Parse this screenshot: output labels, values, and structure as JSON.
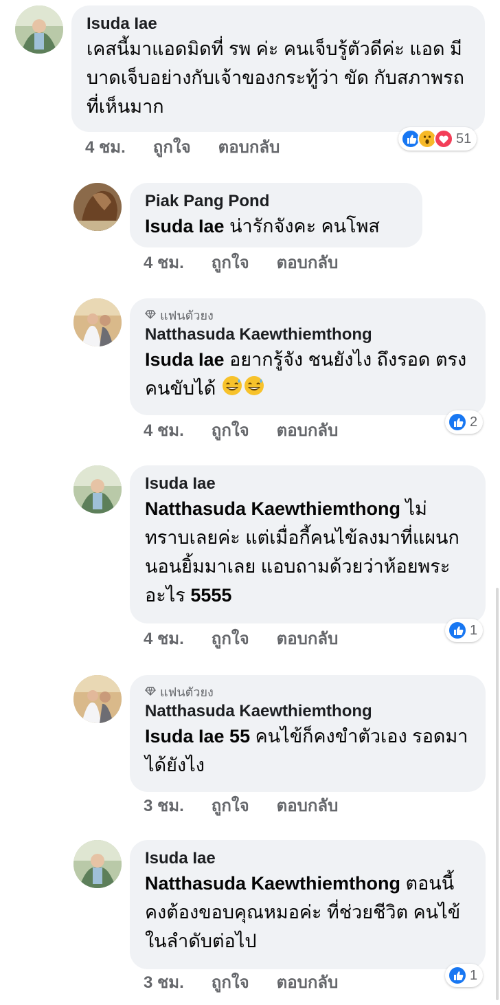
{
  "comments": [
    {
      "author": "Isuda Iae",
      "badge": "",
      "tag": "",
      "text": "เคสนี้มาแอดมิดที่ รพ ค่ะ คนเจ็บรู้ตัวดีค่ะ แอด มีบาดเจ็บอย่างกับเจ้าของกระทู้ว่า ขัด กับสภาพรถที่เห็นมาก",
      "time": "4 ชม.",
      "like_label": "ถูกใจ",
      "reply_label": "ตอบกลับ",
      "reactions": [
        "like-icon",
        "wow-icon",
        "love-icon"
      ],
      "reaction_count": "51"
    },
    {
      "author": "Piak Pang Pond",
      "badge": "",
      "tag": "Isuda Iae",
      "text": " น่ารักจังคะ คนโพส",
      "time": "4 ชม.",
      "like_label": "ถูกใจ",
      "reply_label": "ตอบกลับ",
      "reactions": [],
      "reaction_count": ""
    },
    {
      "author": "Natthasuda Kaewthiemthong",
      "badge": "แฟนตัวยง",
      "tag": "Isuda Iae",
      "text": "  อยากรู้จัง ชนยังไง ถึงรอด ตรงคนขับได้ ",
      "time": "4 ชม.",
      "like_label": "ถูกใจ",
      "reply_label": "ตอบกลับ",
      "reactions": [
        "like-icon"
      ],
      "reaction_count": "2"
    },
    {
      "author": "Isuda Iae",
      "badge": "",
      "tag": "Natthasuda Kaewthiemthong",
      "text": " ไม่ทราบเลยค่ะ แต่เมื่อกี้คนไข้ลงมาที่แผนก นอนยิ้มมาเลย แอบถามด้วยว่าห้อยพระอะไร ",
      "bold_tail": "5555",
      "time": "4 ชม.",
      "like_label": "ถูกใจ",
      "reply_label": "ตอบกลับ",
      "reactions": [
        "like-icon"
      ],
      "reaction_count": "1"
    },
    {
      "author": "Natthasuda Kaewthiemthong",
      "badge": "แฟนตัวยง",
      "tag": "Isuda Iae 55",
      "text": " คนไข้ก็คงขำตัวเอง รอดมาได้ยังไง",
      "time": "3 ชม.",
      "like_label": "ถูกใจ",
      "reply_label": "ตอบกลับ",
      "reactions": [],
      "reaction_count": ""
    },
    {
      "author": "Isuda Iae",
      "badge": "",
      "tag": "Natthasuda Kaewthiemthong",
      "text": " ตอนนี้คงต้องขอบคุณหมอค่ะ ที่ช่วยชีวิต คนไข้ในลำดับต่อไป",
      "time": "3 ชม.",
      "like_label": "ถูกใจ",
      "reply_label": "ตอบกลับ",
      "reactions": [
        "like-icon"
      ],
      "reaction_count": "1"
    }
  ],
  "colors": {
    "bubble": "#f0f2f5",
    "meta_text": "#65676b",
    "like_blue": "#1877f2",
    "love_red": "#f33e58",
    "wow_yellow": "#f7b928"
  }
}
